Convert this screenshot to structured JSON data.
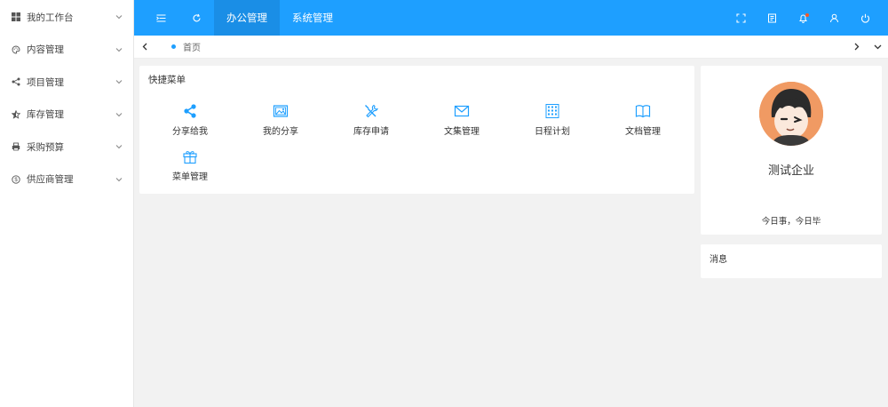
{
  "sidebar": {
    "items": [
      {
        "label": "我的工作台",
        "icon": "windows-icon"
      },
      {
        "label": "内容管理",
        "icon": "palette-icon"
      },
      {
        "label": "项目管理",
        "icon": "share-nodes-icon"
      },
      {
        "label": "库存管理",
        "icon": "star-half-icon"
      },
      {
        "label": "采购预算",
        "icon": "printer-icon"
      },
      {
        "label": "供应商管理",
        "icon": "dollar-circle-icon"
      }
    ]
  },
  "topbar": {
    "tabs": [
      "办公管理",
      "系统管理"
    ],
    "active_tab": "办公管理"
  },
  "tabbar": {
    "home_tab": "首页"
  },
  "quick_menu": {
    "title": "快捷菜单",
    "items": [
      {
        "label": "分享给我",
        "icon": "share-icon"
      },
      {
        "label": "我的分享",
        "icon": "image-icon"
      },
      {
        "label": "库存申请",
        "icon": "tools-icon"
      },
      {
        "label": "文集管理",
        "icon": "mail-icon"
      },
      {
        "label": "日程计划",
        "icon": "calendar-grid-icon"
      },
      {
        "label": "文档管理",
        "icon": "book-icon"
      },
      {
        "label": "菜单管理",
        "icon": "gift-icon"
      }
    ]
  },
  "profile": {
    "company": "测试企业",
    "motto": "今日事，今日毕"
  },
  "messages": {
    "title": "消息"
  },
  "colors": {
    "primary": "#1e9fff",
    "background": "#f2f2f2",
    "notification_dot": "#ff5722"
  }
}
